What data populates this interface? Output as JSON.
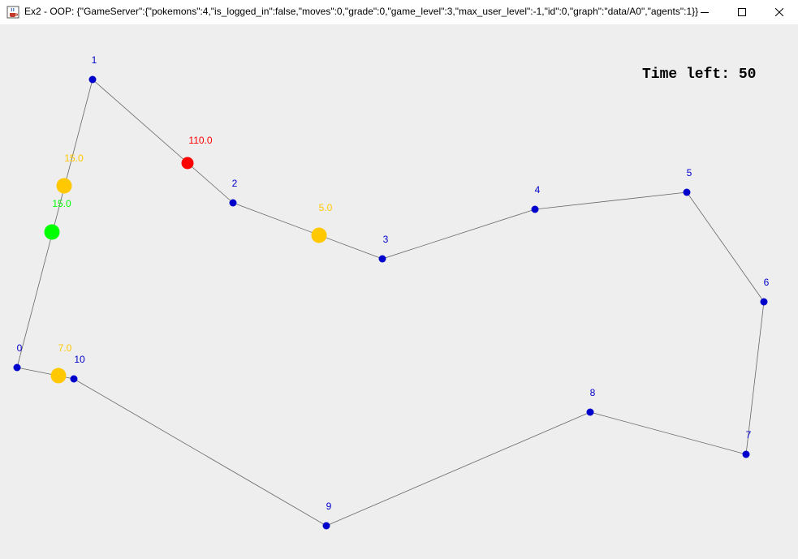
{
  "window": {
    "title": "Ex2 - OOP: {\"GameServer\":{\"pokemons\":4,\"is_logged_in\":false,\"moves\":0,\"grade\":0,\"game_level\":3,\"max_user_level\":-1,\"id\":0,\"graph\":\"data/A0\",\"agents\":1}}",
    "icon": "java-cup-icon",
    "buttons": [
      "minimize-icon",
      "maximize-icon",
      "close-icon"
    ]
  },
  "hud": {
    "label": "Time left:",
    "value": "50"
  },
  "colors": {
    "background": "#eeeeee",
    "node": "#0000cc",
    "node_label": "#0000cc",
    "edge": "#666666",
    "agent": "#ff0000",
    "pokemon_yellow": "#ffc800",
    "pokemon_green": "#00ff00"
  },
  "graph": {
    "nodes": [
      {
        "id": "0"
      },
      {
        "id": "1"
      },
      {
        "id": "2"
      },
      {
        "id": "3"
      },
      {
        "id": "4"
      },
      {
        "id": "5"
      },
      {
        "id": "6"
      },
      {
        "id": "7"
      },
      {
        "id": "8"
      },
      {
        "id": "9"
      },
      {
        "id": "10"
      }
    ],
    "edges": [
      [
        "0",
        "1"
      ],
      [
        "1",
        "2"
      ],
      [
        "2",
        "3"
      ],
      [
        "3",
        "4"
      ],
      [
        "4",
        "5"
      ],
      [
        "5",
        "6"
      ],
      [
        "6",
        "7"
      ],
      [
        "7",
        "8"
      ],
      [
        "8",
        "9"
      ],
      [
        "9",
        "10"
      ],
      [
        "10",
        "0"
      ]
    ]
  },
  "agents": [
    {
      "label": "110.0",
      "color": "red"
    }
  ],
  "pokemons": [
    {
      "label": "15.0",
      "color": "yellow"
    },
    {
      "label": "15.0",
      "color": "green"
    },
    {
      "label": "5.0",
      "color": "yellow"
    },
    {
      "label": "7.0",
      "color": "yellow"
    }
  ]
}
